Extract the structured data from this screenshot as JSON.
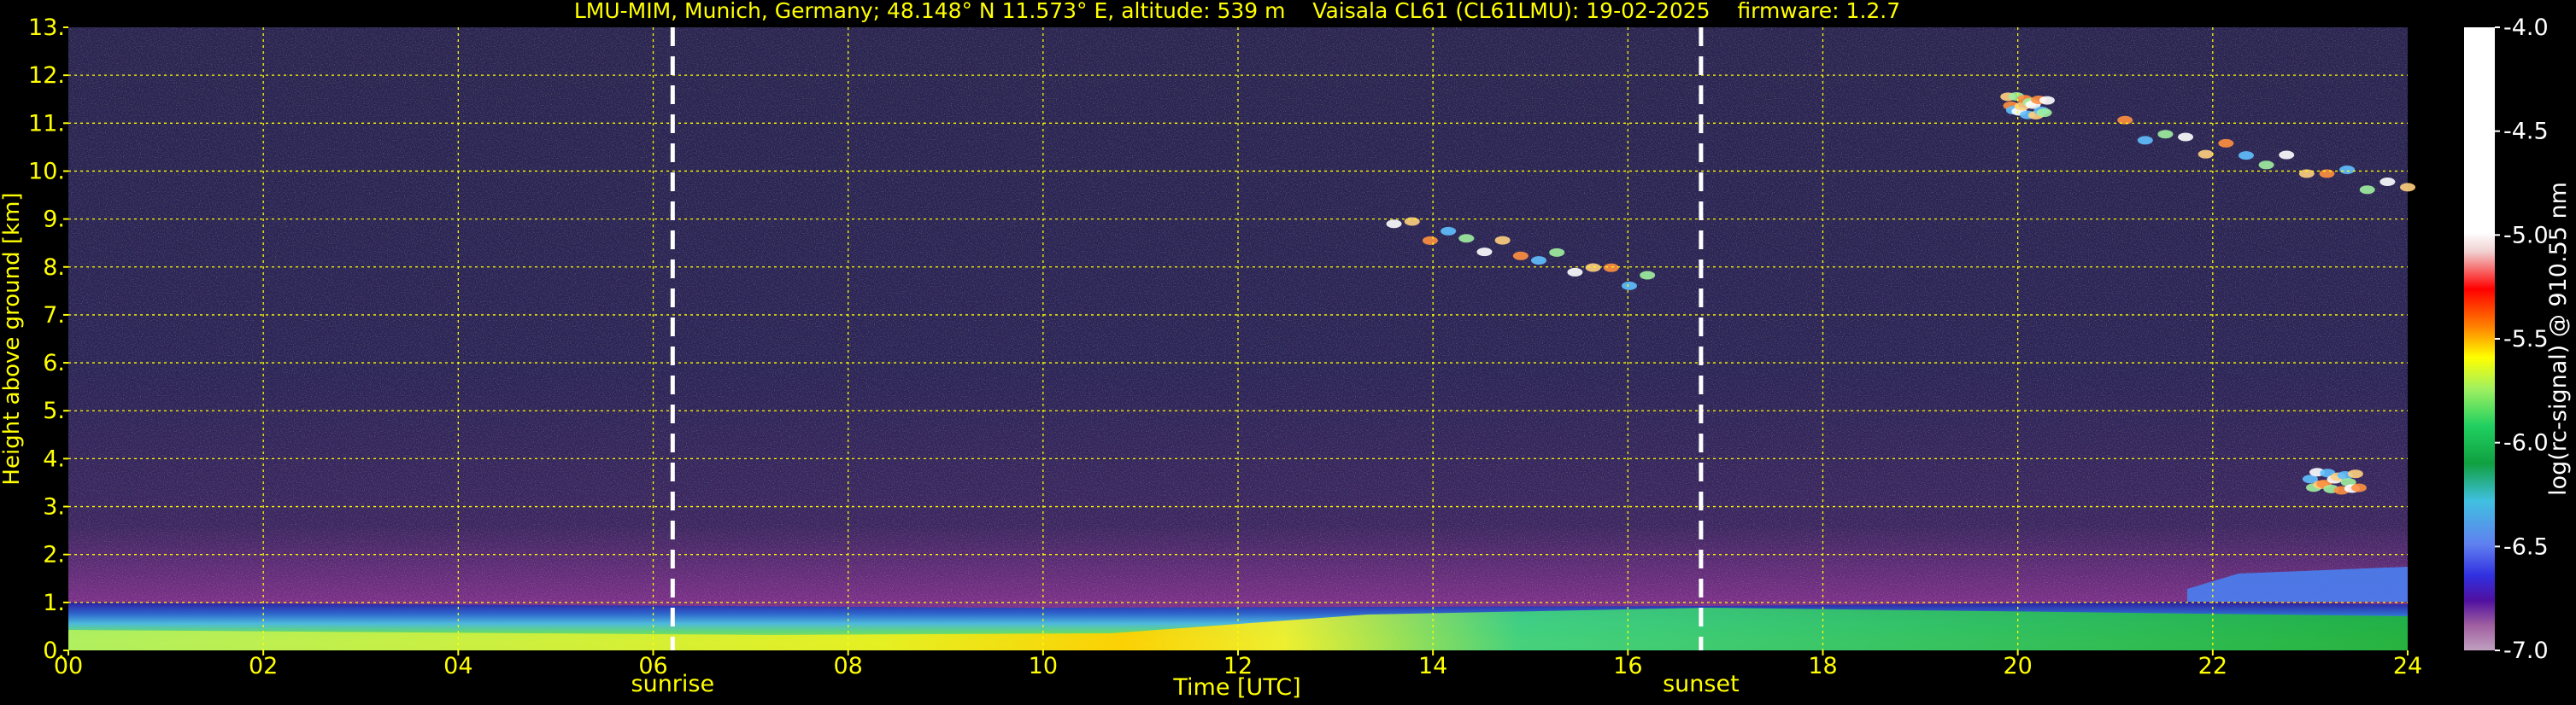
{
  "chart_data": {
    "type": "heatmap",
    "title": "LMU-MIM, Munich, Germany; 48.148° N 11.573° E, altitude: 539 m    Vaisala CL61 (CL61LMU): 19-02-2025    firmware: 1.2.7",
    "xlabel": "Time [UTC]",
    "ylabel": "Height above ground [km]",
    "xlim": [
      0,
      24
    ],
    "ylim": [
      0,
      13
    ],
    "x_ticks": [
      0,
      2,
      4,
      6,
      8,
      10,
      12,
      14,
      16,
      18,
      20,
      22,
      24
    ],
    "x_tick_labels": [
      "00",
      "02",
      "04",
      "06",
      "08",
      "10",
      "12",
      "14",
      "16",
      "18",
      "20",
      "22",
      "24"
    ],
    "y_ticks": [
      0,
      1,
      2,
      3,
      4,
      5,
      6,
      7,
      8,
      9,
      10,
      11,
      12,
      13
    ],
    "y_tick_labels": [
      "0.",
      "1.",
      "2.",
      "3.",
      "4.",
      "5.",
      "6.",
      "7.",
      "8.",
      "9.",
      "10.",
      "11.",
      "12.",
      "13."
    ],
    "grid": true,
    "annotations": [
      {
        "text": "sunrise",
        "x": 6.2
      },
      {
        "text": "sunset",
        "x": 16.75
      }
    ],
    "colorbar": {
      "label": "log(rc-signal) @ 910.55 nm",
      "range": [
        -7.0,
        -4.0
      ],
      "ticks": [
        -4.0,
        -4.5,
        -5.0,
        -5.5,
        -6.0,
        -6.5,
        -7.0
      ],
      "tick_labels": [
        "-4.0",
        "-4.5",
        "-5.0",
        "-5.5",
        "-6.0",
        "-6.5",
        "-7.0"
      ]
    },
    "features": {
      "boundary_layer_top_km": 1.0,
      "aerosol_layer_top_km": 0.5,
      "cloud_segments": [
        {
          "t_start": 13.6,
          "t_end": 16.2,
          "h_start": 8.9,
          "h_end": 7.7
        },
        {
          "t_start": 19.9,
          "t_end": 20.3,
          "h_start": 11.4,
          "h_end": 11.3
        },
        {
          "t_start": 21.1,
          "t_end": 24.0,
          "h_start": 10.9,
          "h_end": 9.6
        },
        {
          "t_start": 23.0,
          "t_end": 23.5,
          "h_start": 3.55,
          "h_end": 3.5
        }
      ]
    }
  },
  "colors": {
    "text": "#ffff00",
    "background": "#000000",
    "grid": "#ffff00",
    "marker_line": "#ffffff"
  }
}
